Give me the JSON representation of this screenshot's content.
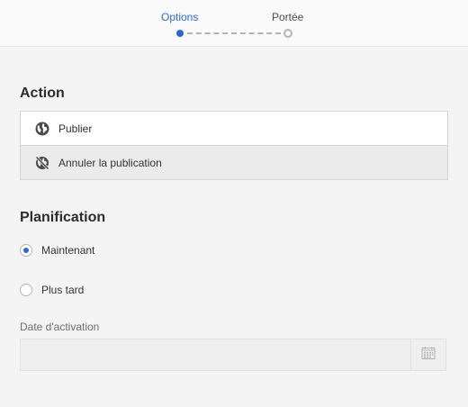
{
  "stepper": {
    "steps": [
      {
        "label": "Options",
        "active": true
      },
      {
        "label": "Portée",
        "active": false
      }
    ]
  },
  "action": {
    "title": "Action",
    "items": [
      {
        "label": "Publier",
        "icon": "globe-icon",
        "selected": false
      },
      {
        "label": "Annuler la publication",
        "icon": "globe-strike-icon",
        "selected": true
      }
    ]
  },
  "planning": {
    "title": "Planification",
    "options": [
      {
        "label": "Maintenant",
        "checked": true
      },
      {
        "label": "Plus tard",
        "checked": false
      }
    ],
    "date_label": "Date d'activation",
    "date_value": "",
    "calendar_icon": "calendar-icon"
  },
  "colors": {
    "accent": "#2d6bc8",
    "background": "#f4f4f4",
    "header_background": "#fafafa"
  }
}
